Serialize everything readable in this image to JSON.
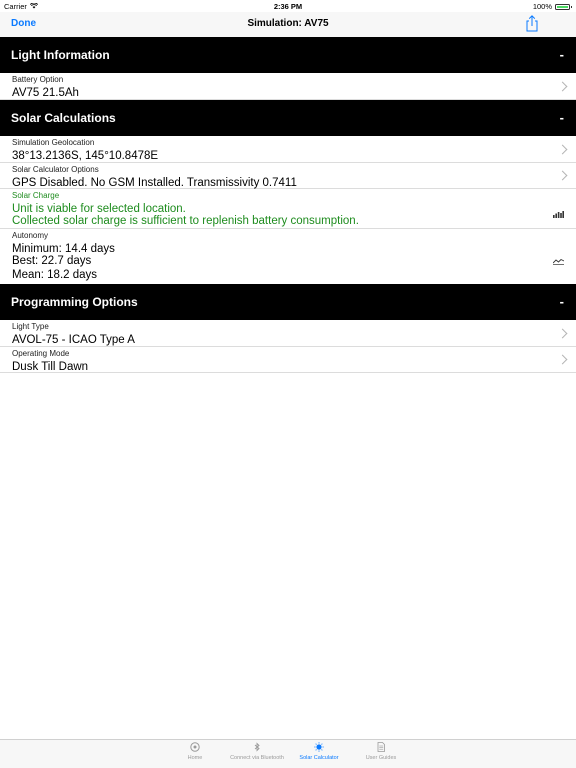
{
  "status_bar": {
    "carrier": "Carrier",
    "time": "2:36 PM",
    "battery": "100%"
  },
  "nav": {
    "done_label": "Done",
    "title": "Simulation: AV75",
    "share_icon": "share-icon"
  },
  "sections": {
    "light_info": {
      "title": "Light Information",
      "toggle": "-",
      "battery": {
        "caption": "Battery Option",
        "value": "AV75 21.5Ah"
      }
    },
    "solar": {
      "title": "Solar Calculations",
      "toggle": "-",
      "geolocation": {
        "caption": "Simulation Geolocation",
        "value": "38°13.2136S, 145°10.8478E"
      },
      "options": {
        "caption": "Solar Calculator Options",
        "value": "GPS Disabled. No GSM Installed. Transmissivity 0.7411"
      },
      "charge": {
        "caption": "Solar Charge",
        "line1": "Unit is viable for selected location.",
        "line2": "Collected solar charge is sufficient to replenish battery consumption.",
        "color": "#1e8c1e"
      },
      "autonomy": {
        "caption": "Autonomy",
        "min": "Minimum: 14.4 days",
        "best": "Best: 22.7 days",
        "mean": "Mean: 18.2 days"
      }
    },
    "programming": {
      "title": "Programming Options",
      "toggle": "-",
      "light_type": {
        "caption": "Light Type",
        "value": "AVOL-75 - ICAO Type A"
      },
      "operating_mode": {
        "caption": "Operating Mode",
        "value": "Dusk Till Dawn"
      }
    }
  },
  "tabs": [
    {
      "label": "Home",
      "icon": "home-icon"
    },
    {
      "label": "Connect via Bluetooth",
      "icon": "bluetooth-icon"
    },
    {
      "label": "Solar Calculator",
      "icon": "sun-icon",
      "active": true
    },
    {
      "label": "User Guides",
      "icon": "document-icon"
    }
  ],
  "colors": {
    "accent": "#0a7aff",
    "header_bg": "#000000",
    "viable_text": "#1e8c1e"
  }
}
